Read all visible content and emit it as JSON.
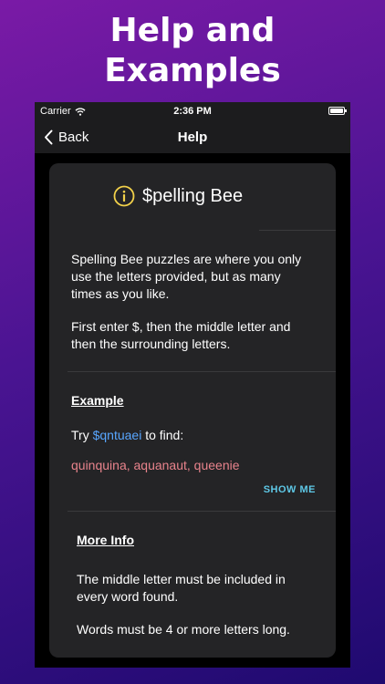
{
  "headline": {
    "line1": "Help and",
    "line2": "Examples"
  },
  "status_bar": {
    "carrier": "Carrier",
    "time": "2:36 PM"
  },
  "nav": {
    "back_label": "Back",
    "title": "Help"
  },
  "card": {
    "title": "$pelling Bee",
    "intro": {
      "para1_line1": "Spelling Bee puzzles are where you only",
      "para1_line2": "use the letters provided, but as many",
      "para1_line3": "times as you like.",
      "para2_line1": "First enter $, then the middle letter and",
      "para2_line2": "then the surrounding letters."
    },
    "example": {
      "title": "Example",
      "try_prefix": "Try ",
      "query": "$qntuaei",
      "try_suffix": " to find:",
      "results": "quinquina, aquanaut, queenie",
      "show_me_label": "SHOW ME"
    },
    "more_info": {
      "title": "More Info",
      "line1": "The middle letter must be included in",
      "line2": "every word found.",
      "line3": "Words must be 4 or more letters long."
    }
  },
  "colors": {
    "accent_blue": "#58a6ff",
    "result_red": "#e8838c",
    "show_me_cyan": "#5ec8e6",
    "info_icon_yellow": "#f2d14a"
  },
  "icons": {
    "wifi": "wifi-icon",
    "battery": "battery-icon",
    "back": "chevron-left-icon",
    "info": "info-icon"
  }
}
